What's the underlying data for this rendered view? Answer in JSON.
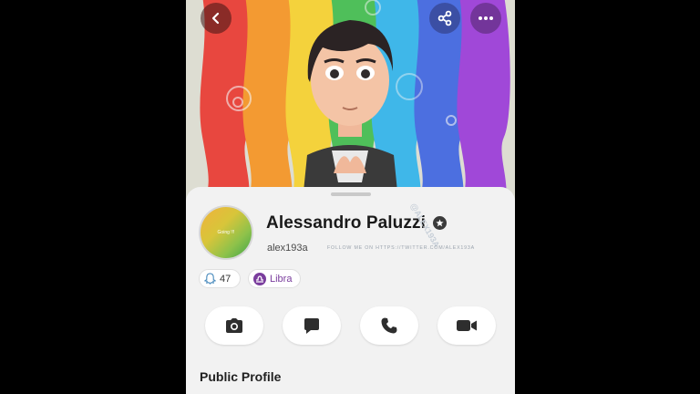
{
  "profile": {
    "display_name": "Alessandro Paluzzi",
    "username": "alex193a",
    "avatar_label": "Going !!!",
    "watermark_vertical": "@ALEX193A",
    "watermark_horizontal": "FOLLOW ME ON HTTPS://TWITTER.COM/ALEX193A"
  },
  "badges": {
    "snapscore": "47",
    "zodiac": "Libra"
  },
  "actions": [
    {
      "icon": "camera-icon"
    },
    {
      "icon": "chat-icon"
    },
    {
      "icon": "phone-icon"
    },
    {
      "icon": "video-icon"
    }
  ],
  "sections": {
    "public_profile": "Public Profile"
  },
  "colors": {
    "rainbow": [
      "#e8473f",
      "#f39a32",
      "#f4d23c",
      "#4fbf5a",
      "#3fb7e9",
      "#4c6fe0",
      "#a048d8"
    ],
    "zodiac_accent": "#7a3d9d"
  }
}
